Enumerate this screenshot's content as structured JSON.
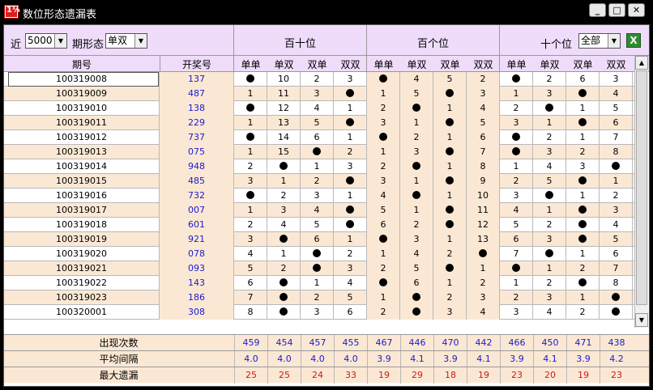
{
  "window": {
    "title": "数位形态遗漏表",
    "app_icon_text": "1¼"
  },
  "controls": {
    "recent_label": "近",
    "recent_value": "5000",
    "period_form_label": "期形态",
    "period_form_value": "单双",
    "tens_digit_label": "十个位",
    "tens_digit_value": "全部"
  },
  "groups": {
    "g1": "百十位",
    "g2": "百个位",
    "g3": "十个位"
  },
  "columns": {
    "issue": "期号",
    "draw": "开奖号",
    "sub": [
      "单单",
      "单双",
      "双单",
      "双双",
      "单单",
      "单双",
      "双单",
      "双双",
      "单单",
      "单双",
      "双单",
      "双双"
    ]
  },
  "rows": [
    {
      "issue": "100319008",
      "draw": "137",
      "vals": [
        "●",
        "10",
        "2",
        "3",
        "●",
        "4",
        "5",
        "2",
        "●",
        "2",
        "6",
        "3"
      ]
    },
    {
      "issue": "100319009",
      "draw": "487",
      "vals": [
        "1",
        "11",
        "3",
        "●",
        "1",
        "5",
        "●",
        "3",
        "1",
        "3",
        "●",
        "4"
      ]
    },
    {
      "issue": "100319010",
      "draw": "138",
      "vals": [
        "●",
        "12",
        "4",
        "1",
        "2",
        "●",
        "1",
        "4",
        "2",
        "●",
        "1",
        "5"
      ]
    },
    {
      "issue": "100319011",
      "draw": "229",
      "vals": [
        "1",
        "13",
        "5",
        "●",
        "3",
        "1",
        "●",
        "5",
        "3",
        "1",
        "●",
        "6"
      ]
    },
    {
      "issue": "100319012",
      "draw": "737",
      "vals": [
        "●",
        "14",
        "6",
        "1",
        "●",
        "2",
        "1",
        "6",
        "●",
        "2",
        "1",
        "7"
      ]
    },
    {
      "issue": "100319013",
      "draw": "075",
      "vals": [
        "1",
        "15",
        "●",
        "2",
        "1",
        "3",
        "●",
        "7",
        "●",
        "3",
        "2",
        "8"
      ]
    },
    {
      "issue": "100319014",
      "draw": "948",
      "vals": [
        "2",
        "●",
        "1",
        "3",
        "2",
        "●",
        "1",
        "8",
        "1",
        "4",
        "3",
        "●"
      ]
    },
    {
      "issue": "100319015",
      "draw": "485",
      "vals": [
        "3",
        "1",
        "2",
        "●",
        "3",
        "1",
        "●",
        "9",
        "2",
        "5",
        "●",
        "1"
      ]
    },
    {
      "issue": "100319016",
      "draw": "732",
      "vals": [
        "●",
        "2",
        "3",
        "1",
        "4",
        "●",
        "1",
        "10",
        "3",
        "●",
        "1",
        "2"
      ]
    },
    {
      "issue": "100319017",
      "draw": "007",
      "vals": [
        "1",
        "3",
        "4",
        "●",
        "5",
        "1",
        "●",
        "11",
        "4",
        "1",
        "●",
        "3"
      ]
    },
    {
      "issue": "100319018",
      "draw": "601",
      "vals": [
        "2",
        "4",
        "5",
        "●",
        "6",
        "2",
        "●",
        "12",
        "5",
        "2",
        "●",
        "4"
      ]
    },
    {
      "issue": "100319019",
      "draw": "921",
      "vals": [
        "3",
        "●",
        "6",
        "1",
        "●",
        "3",
        "1",
        "13",
        "6",
        "3",
        "●",
        "5"
      ]
    },
    {
      "issue": "100319020",
      "draw": "078",
      "vals": [
        "4",
        "1",
        "●",
        "2",
        "1",
        "4",
        "2",
        "●",
        "7",
        "●",
        "1",
        "6"
      ]
    },
    {
      "issue": "100319021",
      "draw": "093",
      "vals": [
        "5",
        "2",
        "●",
        "3",
        "2",
        "5",
        "●",
        "1",
        "●",
        "1",
        "2",
        "7"
      ]
    },
    {
      "issue": "100319022",
      "draw": "143",
      "vals": [
        "6",
        "●",
        "1",
        "4",
        "●",
        "6",
        "1",
        "2",
        "1",
        "2",
        "●",
        "8"
      ]
    },
    {
      "issue": "100319023",
      "draw": "186",
      "vals": [
        "7",
        "●",
        "2",
        "5",
        "1",
        "●",
        "2",
        "3",
        "2",
        "3",
        "1",
        "●"
      ]
    },
    {
      "issue": "100320001",
      "draw": "308",
      "vals": [
        "8",
        "●",
        "3",
        "6",
        "2",
        "●",
        "3",
        "4",
        "3",
        "4",
        "2",
        "●"
      ]
    }
  ],
  "footer": {
    "appear_label": "出现次数",
    "appear": [
      "459",
      "454",
      "457",
      "455",
      "467",
      "446",
      "470",
      "442",
      "466",
      "450",
      "471",
      "438"
    ],
    "avg_label": "平均间隔",
    "avg": [
      "4.0",
      "4.0",
      "4.0",
      "4.0",
      "3.9",
      "4.1",
      "3.9",
      "4.1",
      "3.9",
      "4.1",
      "3.9",
      "4.2"
    ],
    "max_label": "最大遗漏",
    "max": [
      "25",
      "25",
      "24",
      "33",
      "19",
      "29",
      "18",
      "19",
      "23",
      "20",
      "19",
      "23"
    ]
  },
  "colors": {
    "header_bg": "#eedcfa",
    "row_alt": "#fbe8d4",
    "blue": "#1a1ad0",
    "red": "#d01818"
  }
}
